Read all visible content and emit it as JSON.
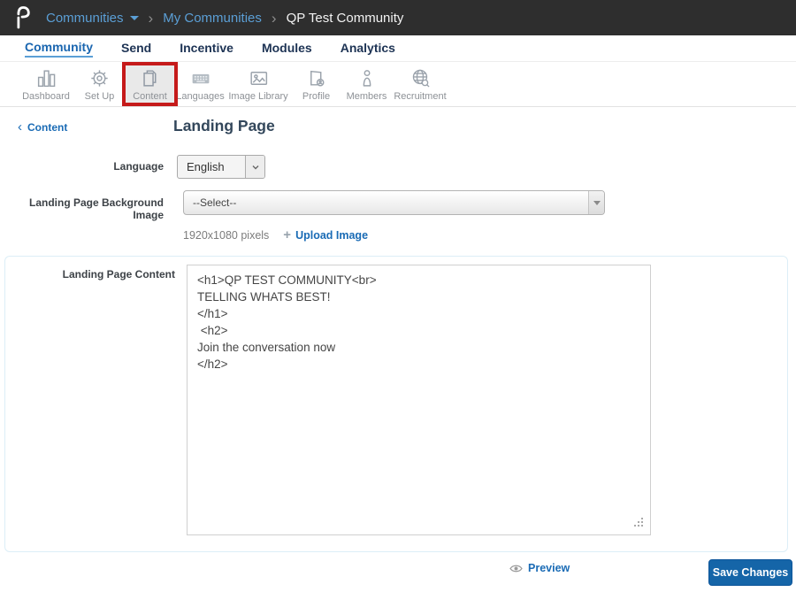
{
  "header": {
    "menu_label": "Communities",
    "separator": "›",
    "breadcrumb": {
      "level1": "My Communities",
      "level2": "QP Test Community"
    }
  },
  "tabs": {
    "items": [
      {
        "label": "Community",
        "active": true
      },
      {
        "label": "Send",
        "active": false
      },
      {
        "label": "Incentive",
        "active": false
      },
      {
        "label": "Modules",
        "active": false
      },
      {
        "label": "Analytics",
        "active": false
      }
    ]
  },
  "toolbar": {
    "items": [
      {
        "label": "Dashboard",
        "icon": "bar-chart-icon",
        "selected": false
      },
      {
        "label": "Set Up",
        "icon": "gear-icon",
        "selected": false
      },
      {
        "label": "Content",
        "icon": "pages-icon",
        "selected": true,
        "annotated": true
      },
      {
        "label": "Languages",
        "icon": "keyboard-icon",
        "selected": false
      },
      {
        "label": "Image Library",
        "icon": "image-icon",
        "selected": false
      },
      {
        "label": "Profile",
        "icon": "folder-person-icon",
        "selected": false
      },
      {
        "label": "Members",
        "icon": "person-icon",
        "selected": false
      },
      {
        "label": "Recruitment",
        "icon": "globe-search-icon",
        "selected": false
      }
    ]
  },
  "page": {
    "back_chevron": "‹",
    "back_link": "Content",
    "title": "Landing Page",
    "form": {
      "language": {
        "label": "Language",
        "value": "English"
      },
      "background_image": {
        "label": "Landing Page Background Image",
        "value": "--Select--",
        "hint": "1920x1080 pixels",
        "plus": "+",
        "upload_link": "Upload Image"
      },
      "content": {
        "label": "Landing Page Content",
        "value": "<h1>QP TEST COMMUNITY<br>\nTELLING WHATS BEST!\n</h1>\n <h2>\nJoin the conversation now\n</h2>"
      }
    },
    "footer": {
      "preview": "Preview",
      "save": "Save Changes"
    }
  },
  "colors": {
    "header_bg": "#2e2e2e",
    "breadcrumb_link": "#5b9fd6",
    "active_tab": "#1a66b0",
    "tab_text": "#1d3354",
    "link": "#1a6bb5",
    "annotation_red": "#c51a1a",
    "selected_tool_bg": "#e9e9e9",
    "panel_border": "#dceef7",
    "save_button_bg": "#1565a8"
  }
}
